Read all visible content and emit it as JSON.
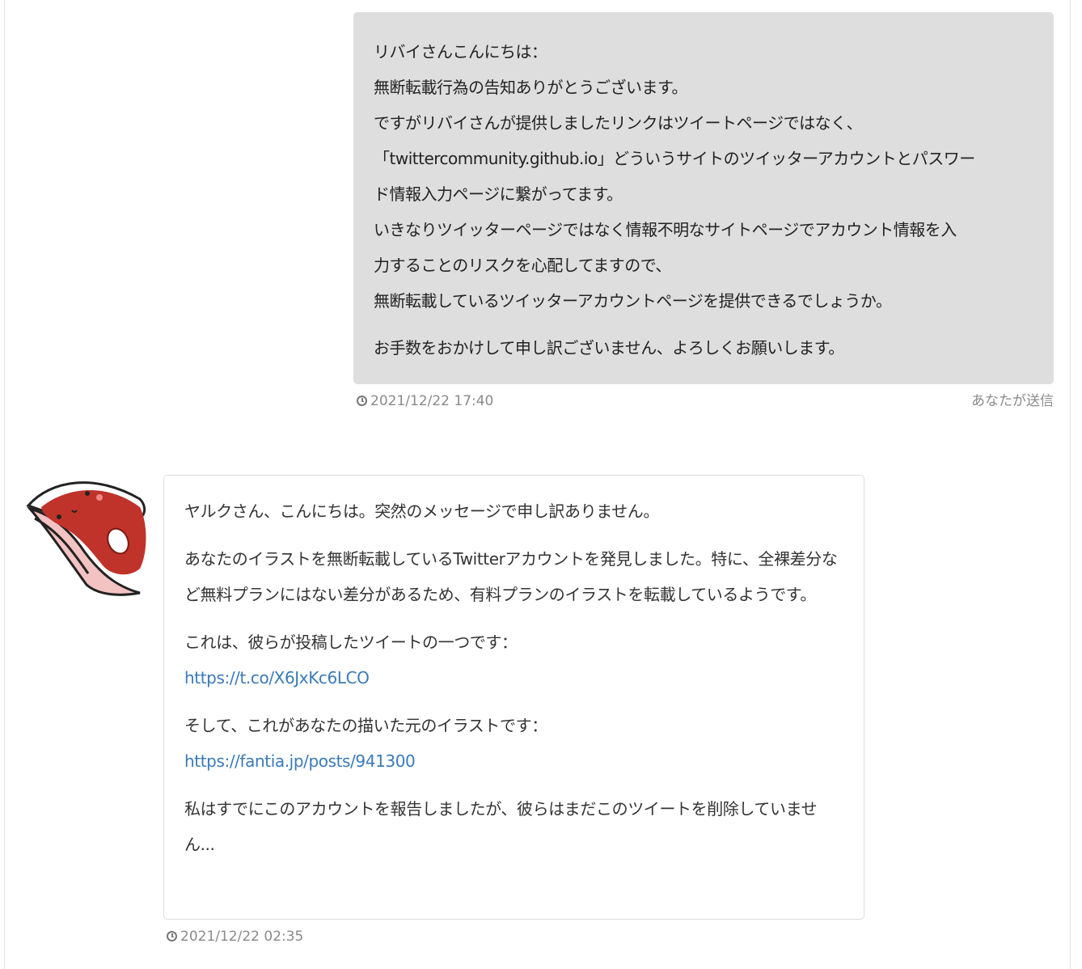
{
  "sent_message": {
    "lines": [
      "リバイさんこんにちは：",
      "無断転載行為の告知ありがとうございます。",
      "ですがリバイさんが提供しましたリンクはツイートページではなく、",
      "「twittercommunity.github.io」どういうサイトのツイッターアカウントとパスワー",
      "ド情報入力ページに繋がってます。",
      "いきなりツイッターページではなく情報不明なサイトページでアカウント情報を入",
      "力することのリスクを心配してますので、",
      "無断転載しているツイッターアカウントページを提供できるでしょうか。"
    ],
    "closing": "お手数をおかけして申し訳ございません、よろしくお願いします。",
    "timestamp": "2021/12/22 17:40",
    "sender_label": "あなたが送信"
  },
  "received_message": {
    "greeting": "ヤルクさん、こんにちは。突然のメッセージで申し訳ありません。",
    "paragraph1": "あなたのイラストを無断転載しているTwitterアカウントを発見しました。特に、全裸差分など無料プランにはない差分があるため、有料プランのイラストを転載しているようです。",
    "tweet_intro": "これは、彼らが投稿したツイートの一つです：",
    "tweet_link": "https://t.co/X6JxKc6LCO",
    "original_intro": "そして、これがあなたの描いた元のイラストです：",
    "original_link": "https://fantia.jp/posts/941300",
    "closing": "私はすでにこのアカウントを報告しましたが、彼らはまだこのツイートを削除していません...",
    "timestamp": "2021/12/22 02:35"
  },
  "icons": {
    "clock": "clock-icon",
    "avatar": "sender-avatar"
  },
  "colors": {
    "sent_bubble": "#dedede",
    "link": "#3a7ab8",
    "avatar_red": "#c0332a"
  }
}
